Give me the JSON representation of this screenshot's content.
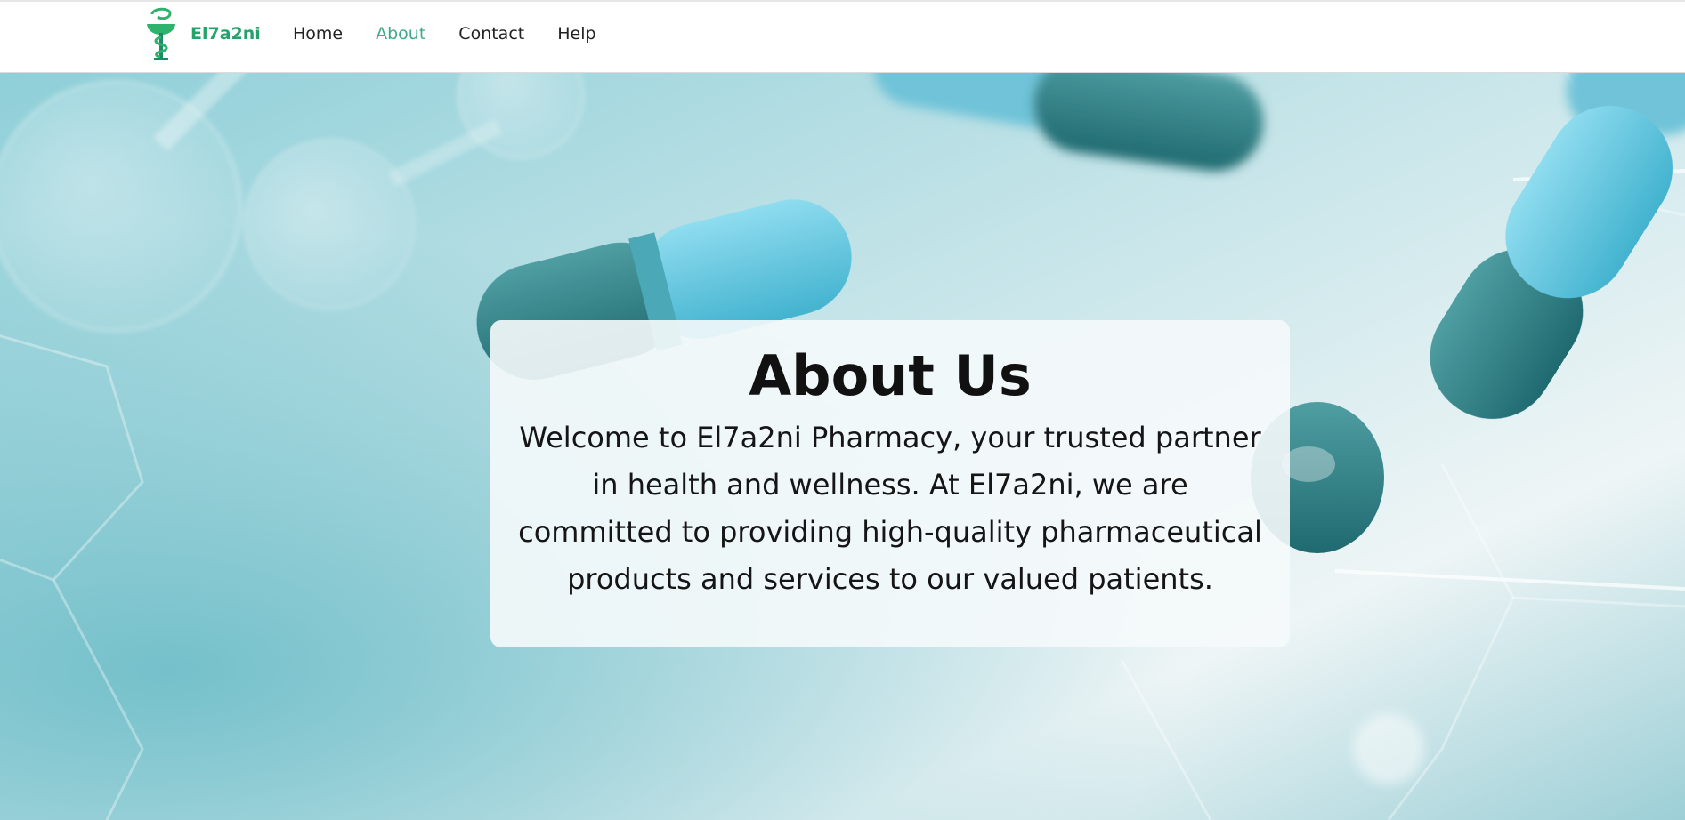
{
  "brand": {
    "name": "El7a2ni",
    "logo_icon": "bowl-of-hygieia-icon",
    "color": "#23a36b"
  },
  "nav": {
    "items": [
      {
        "label": "Home",
        "active": false
      },
      {
        "label": "About",
        "active": true
      },
      {
        "label": "Contact",
        "active": false
      },
      {
        "label": "Help",
        "active": false
      }
    ],
    "active_color": "#3fa98a"
  },
  "hero": {
    "background": "pharmacy-capsules-molecules-image",
    "title": "About Us",
    "text": "Welcome to El7a2ni Pharmacy, your trusted partner in health and wellness. At El7a2ni, we are committed to providing high-quality pharmaceutical products and services to our valued patients."
  }
}
